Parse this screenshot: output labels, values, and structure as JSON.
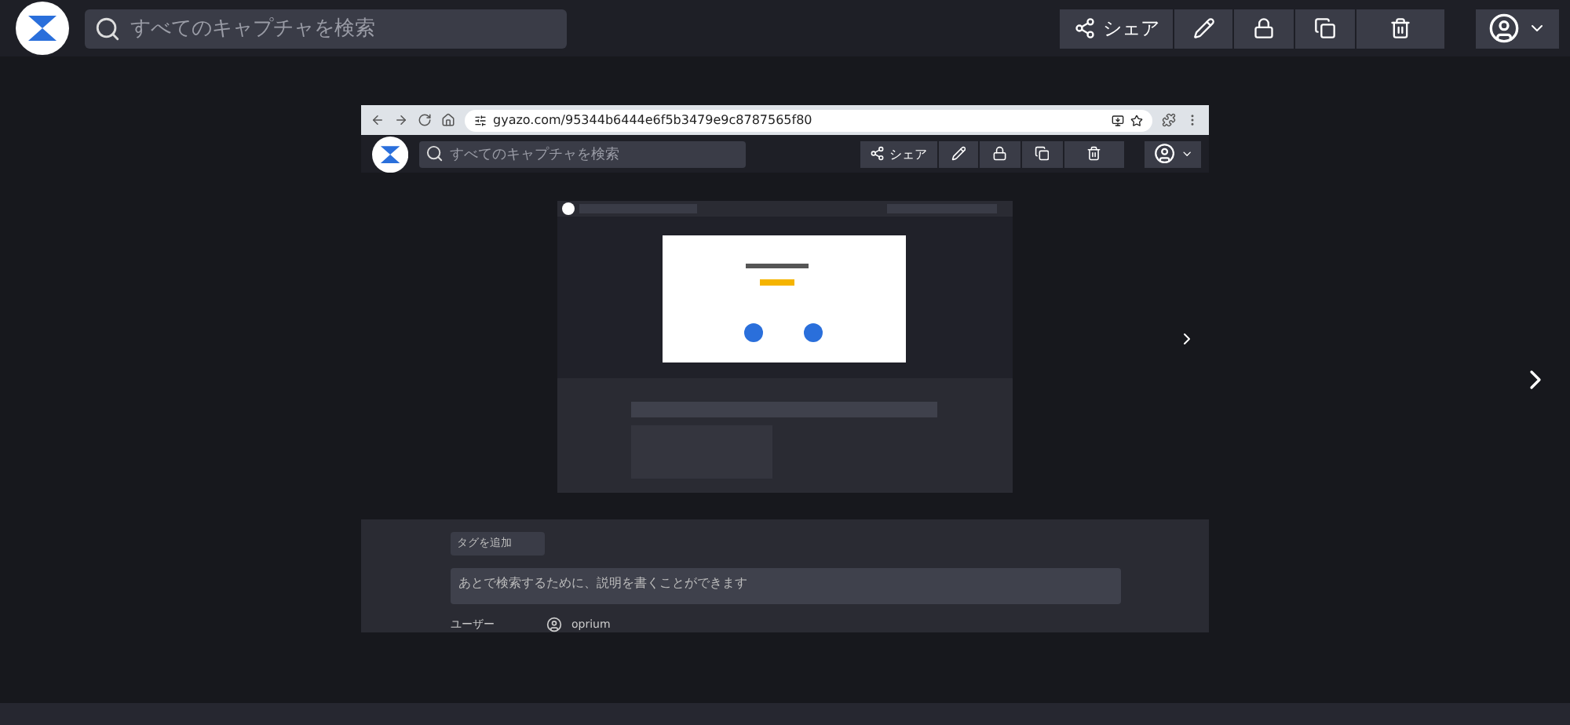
{
  "header": {
    "search": {
      "placeholder": "すべてのキャプチャを検索"
    },
    "share_button": "シェア"
  },
  "capture": {
    "browser": {
      "url": "gyazo.com/95344b6444e6f5b3479e9c8787565f80"
    },
    "app_bar": {
      "search": {
        "placeholder": "すべてのキャプチャを検索"
      },
      "share_button": "シェア"
    },
    "tag_button": "タグを追加",
    "description": {
      "placeholder": "あとで検索するために、説明を書くことができます"
    },
    "user": {
      "label": "ユーザー",
      "name": "oprium"
    }
  }
}
